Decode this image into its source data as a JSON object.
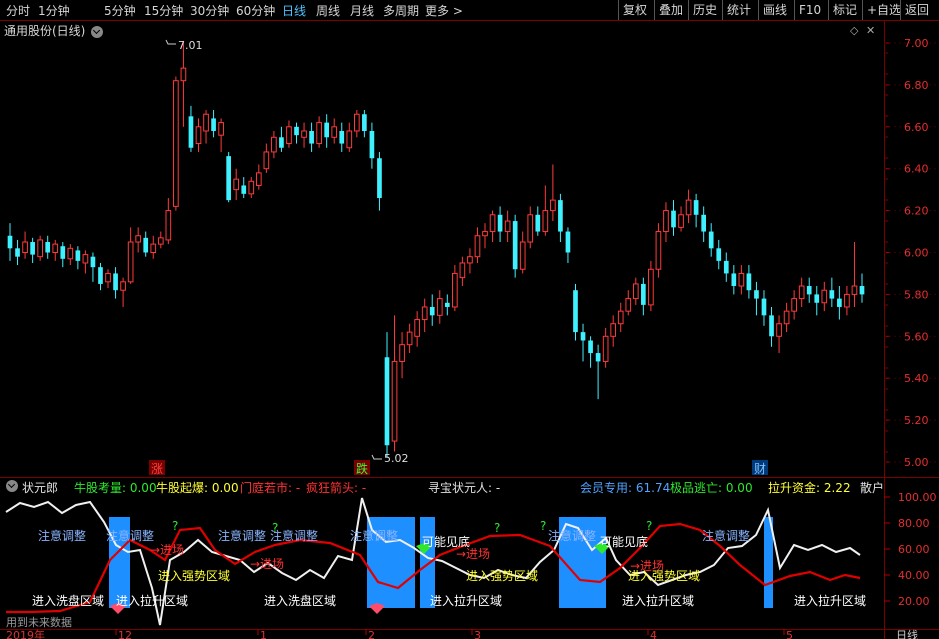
{
  "toolbar": {
    "periods": [
      "分时",
      "1分钟",
      "5分钟",
      "15分钟",
      "30分钟",
      "60分钟",
      "日线",
      "周线",
      "月线",
      "多周期",
      "更多 >"
    ],
    "active_index": 6,
    "actions": [
      "复权",
      "叠加",
      "历史",
      "统计",
      "画线",
      "F10",
      "标记",
      "+自选",
      "返回"
    ]
  },
  "chart_title": "通用股份(日线)",
  "price_axis": [
    "7.00",
    "6.80",
    "6.60",
    "6.40",
    "6.20",
    "6.00",
    "5.80",
    "5.60",
    "5.40",
    "5.20",
    "5.00"
  ],
  "price_markers": {
    "high": "7.01",
    "low": "5.02"
  },
  "event_tags": [
    "涨",
    "跌",
    "财"
  ],
  "indicator": {
    "name": "状元郎",
    "items": [
      {
        "label": "牛股考量:",
        "value": "0.00",
        "color": "#2ee82e"
      },
      {
        "label": "牛股起爆:",
        "value": "0.00",
        "color": "#ffff33"
      },
      {
        "label": "门庭若市:",
        "value": "-",
        "color": "#ff3333"
      },
      {
        "label": "疯狂箭头:",
        "value": "-",
        "color": "#ff3333"
      },
      {
        "label": "寻宝状元人:",
        "value": "-",
        "color": "#e0e0e0"
      },
      {
        "label": "会员专用:",
        "value": "61.74",
        "color": "#4fa3ff"
      },
      {
        "label": "极品逃亡:",
        "value": "0.00",
        "color": "#2ee82e"
      },
      {
        "label": "拉升资金:",
        "value": "2.22",
        "color": "#ffff33"
      },
      {
        "label": "散户",
        "value": "",
        "color": "#e0e0e0"
      }
    ],
    "axis": [
      "100.00",
      "80.00",
      "60.00",
      "40.00",
      "20.00"
    ],
    "annotations": {
      "adjust": "注意调整",
      "bottom": "可能见底",
      "enter": "进场",
      "strong": "进入强势区域",
      "pull": "进入拉升区域",
      "wash": "进入洗盘区域",
      "q": "?"
    }
  },
  "bottom": {
    "note": "用到未来数据",
    "year": "2019年",
    "months": [
      "12",
      "1",
      "2",
      "3",
      "4",
      "5"
    ],
    "period": "日线"
  },
  "colors": {
    "up": "#ff3b3b",
    "down": "#3ff0ff",
    "bg": "#000000",
    "grid": "#7a0000",
    "blue": "#1e8fff"
  }
}
